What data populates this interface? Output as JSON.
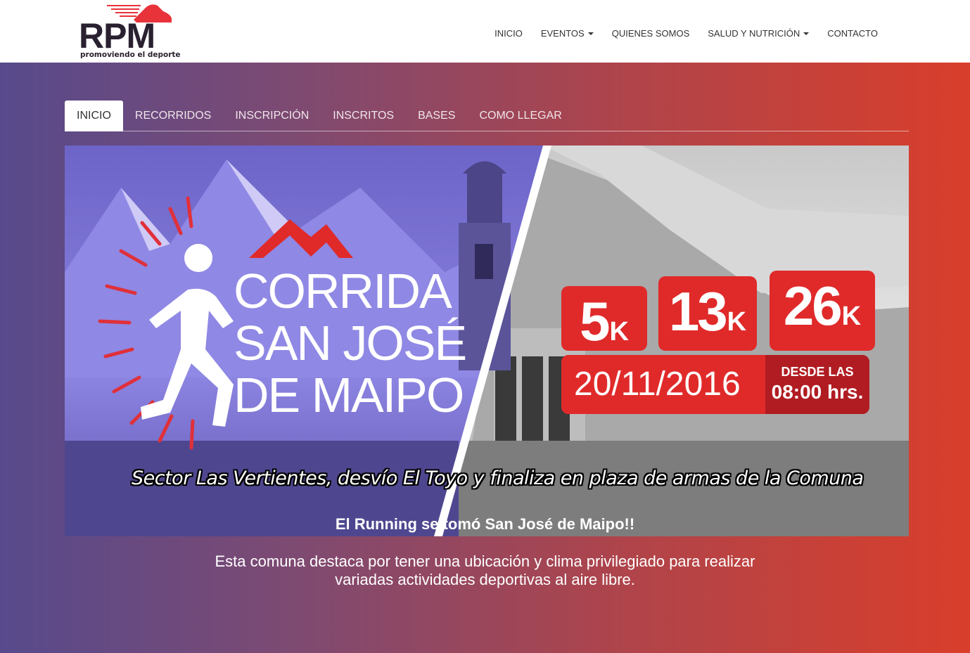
{
  "brand": {
    "logo_text": "RPM",
    "tagline": "promoviendo el deporte",
    "colors": {
      "dark": "#2a2130",
      "accent": "#e8333a"
    }
  },
  "nav": {
    "items": [
      {
        "label": "INICIO",
        "dropdown": false
      },
      {
        "label": "EVENTOS",
        "dropdown": true
      },
      {
        "label": "QUIENES SOMOS",
        "dropdown": false
      },
      {
        "label": "SALUD Y NUTRICIÓN",
        "dropdown": true
      },
      {
        "label": "CONTACTO",
        "dropdown": false
      }
    ]
  },
  "tabs": {
    "active_index": 0,
    "items": [
      "INICIO",
      "RECORRIDOS",
      "INSCRIPCIÓN",
      "INSCRITOS",
      "BASES",
      "COMO LLEGAR"
    ]
  },
  "banner": {
    "title_lines": [
      "CORRIDA",
      "SAN JOSÉ",
      "DE MAIPO"
    ],
    "distances": [
      {
        "num": "5",
        "unit": "K"
      },
      {
        "num": "13",
        "unit": "K"
      },
      {
        "num": "26",
        "unit": "K"
      }
    ],
    "date": "20/11/2016",
    "time_label": "DESDE LAS",
    "time_value": "08:00 hrs.",
    "route": "Sector Las Vertientes, desvío El Toyo y finaliza en plaza de armas de la Comuna",
    "colors": {
      "red": "#e02a2a",
      "dark_red": "#b01c22",
      "purple": "#7a70d6"
    }
  },
  "content": {
    "headline": "El Running se tomó San José de Maipo!!",
    "paragraph": "Esta comuna destaca por tener una ubicación y clima privilegiado para realizar variadas actividades deportivas al aire libre."
  }
}
